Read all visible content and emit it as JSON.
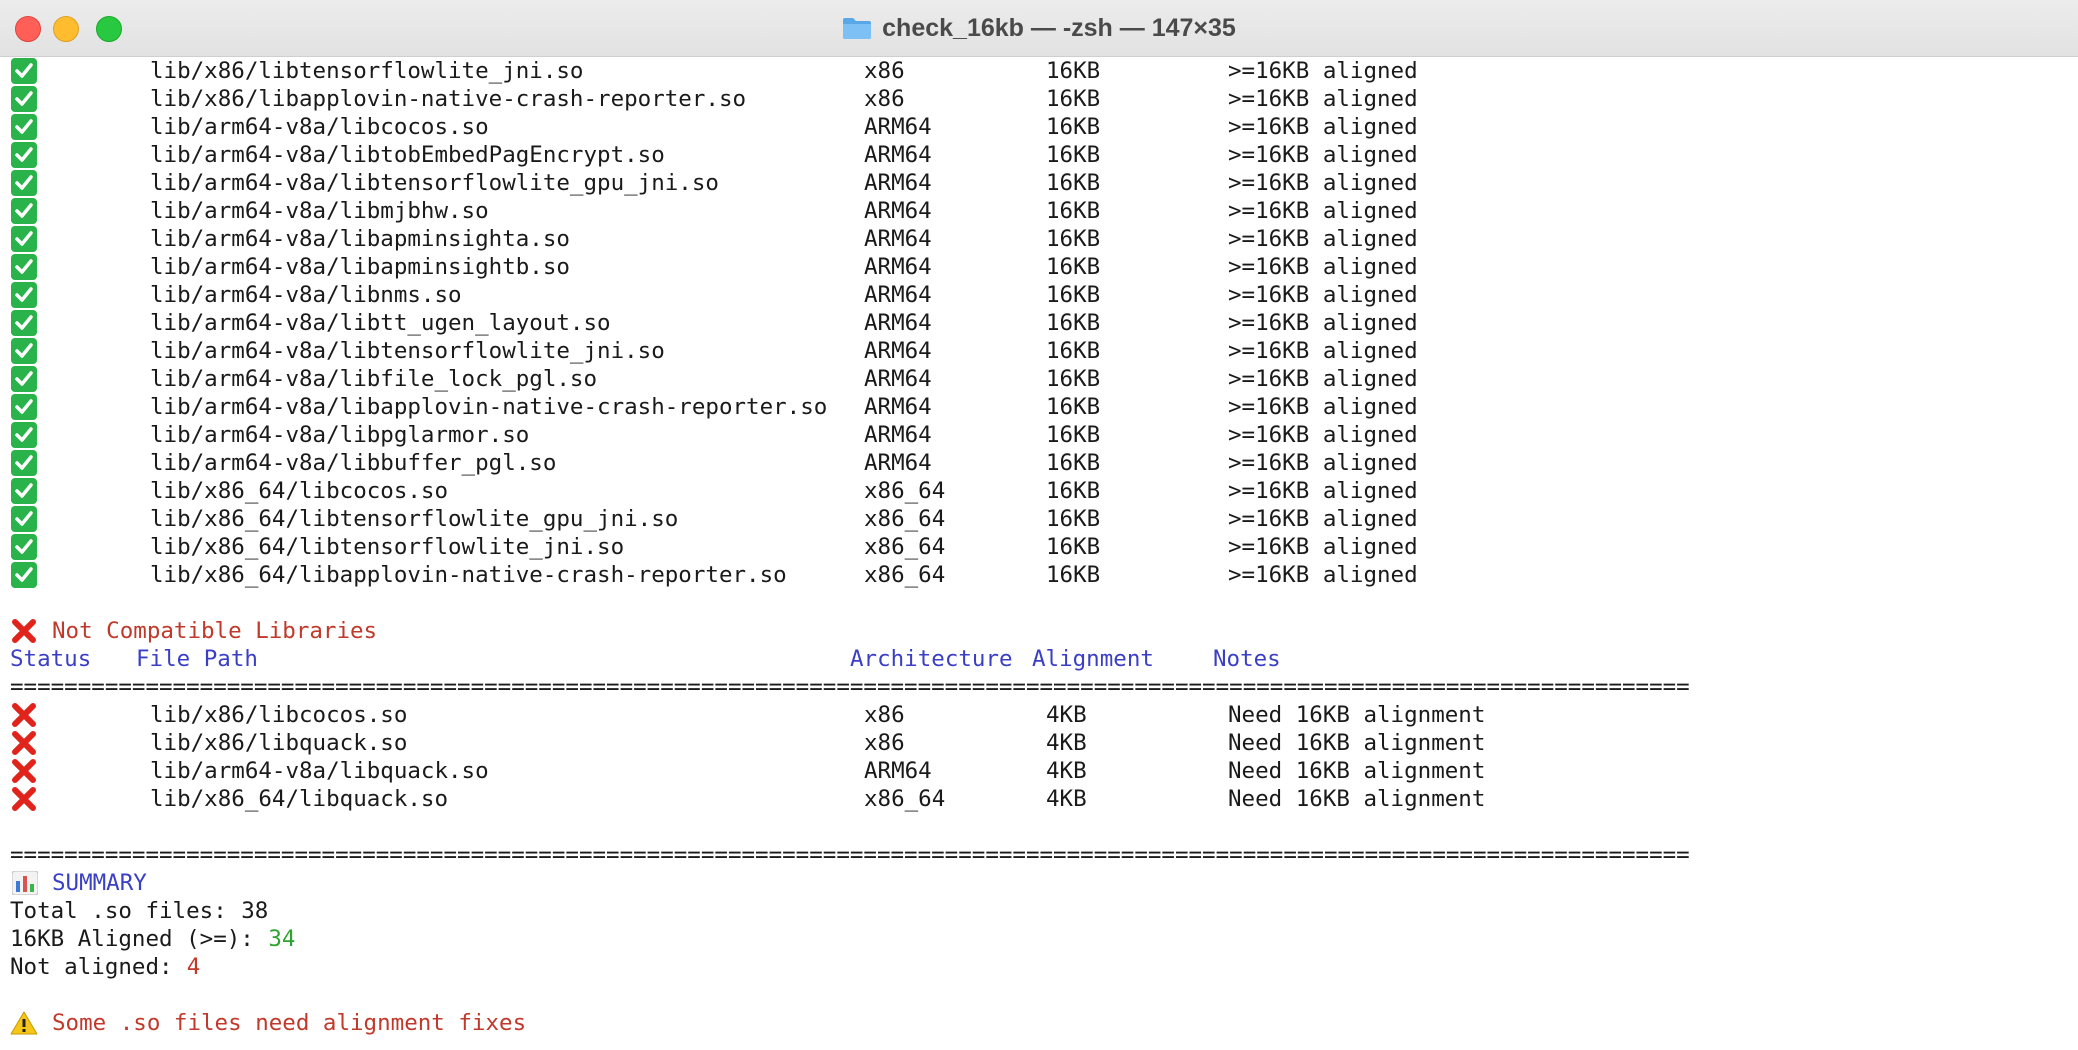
{
  "window": {
    "title": "check_16kb — -zsh — 147×35",
    "folder_icon": "folder-icon"
  },
  "colors": {
    "check": "#29b34a",
    "cross": "#e0241b",
    "header_blue": "#3a3fc4",
    "red_text": "#c0392b",
    "green_text": "#2fa32f"
  },
  "aligned_rows": [
    {
      "path": "lib/x86/libtensorflowlite_jni.so",
      "arch": "x86",
      "size": "16KB",
      "note": ">=16KB aligned"
    },
    {
      "path": "lib/x86/libapplovin-native-crash-reporter.so",
      "arch": "x86",
      "size": "16KB",
      "note": ">=16KB aligned"
    },
    {
      "path": "lib/arm64-v8a/libcocos.so",
      "arch": "ARM64",
      "size": "16KB",
      "note": ">=16KB aligned"
    },
    {
      "path": "lib/arm64-v8a/libtobEmbedPagEncrypt.so",
      "arch": "ARM64",
      "size": "16KB",
      "note": ">=16KB aligned"
    },
    {
      "path": "lib/arm64-v8a/libtensorflowlite_gpu_jni.so",
      "arch": "ARM64",
      "size": "16KB",
      "note": ">=16KB aligned"
    },
    {
      "path": "lib/arm64-v8a/libmjbhw.so",
      "arch": "ARM64",
      "size": "16KB",
      "note": ">=16KB aligned"
    },
    {
      "path": "lib/arm64-v8a/libapminsighta.so",
      "arch": "ARM64",
      "size": "16KB",
      "note": ">=16KB aligned"
    },
    {
      "path": "lib/arm64-v8a/libapminsightb.so",
      "arch": "ARM64",
      "size": "16KB",
      "note": ">=16KB aligned"
    },
    {
      "path": "lib/arm64-v8a/libnms.so",
      "arch": "ARM64",
      "size": "16KB",
      "note": ">=16KB aligned"
    },
    {
      "path": "lib/arm64-v8a/libtt_ugen_layout.so",
      "arch": "ARM64",
      "size": "16KB",
      "note": ">=16KB aligned"
    },
    {
      "path": "lib/arm64-v8a/libtensorflowlite_jni.so",
      "arch": "ARM64",
      "size": "16KB",
      "note": ">=16KB aligned"
    },
    {
      "path": "lib/arm64-v8a/libfile_lock_pgl.so",
      "arch": "ARM64",
      "size": "16KB",
      "note": ">=16KB aligned"
    },
    {
      "path": "lib/arm64-v8a/libapplovin-native-crash-reporter.so",
      "arch": "ARM64",
      "size": "16KB",
      "note": ">=16KB aligned"
    },
    {
      "path": "lib/arm64-v8a/libpglarmor.so",
      "arch": "ARM64",
      "size": "16KB",
      "note": ">=16KB aligned"
    },
    {
      "path": "lib/arm64-v8a/libbuffer_pgl.so",
      "arch": "ARM64",
      "size": "16KB",
      "note": ">=16KB aligned"
    },
    {
      "path": "lib/x86_64/libcocos.so",
      "arch": "x86_64",
      "size": "16KB",
      "note": ">=16KB aligned"
    },
    {
      "path": "lib/x86_64/libtensorflowlite_gpu_jni.so",
      "arch": "x86_64",
      "size": "16KB",
      "note": ">=16KB aligned"
    },
    {
      "path": "lib/x86_64/libtensorflowlite_jni.so",
      "arch": "x86_64",
      "size": "16KB",
      "note": ">=16KB aligned"
    },
    {
      "path": "lib/x86_64/libapplovin-native-crash-reporter.so",
      "arch": "x86_64",
      "size": "16KB",
      "note": ">=16KB aligned"
    }
  ],
  "not_compatible": {
    "title": "Not Compatible Libraries",
    "headers": {
      "status": "Status",
      "path": "File Path",
      "arch": "Architecture",
      "alignment": "Alignment",
      "notes": "Notes"
    },
    "rule": "================================================================================================================================",
    "rows": [
      {
        "path": "lib/x86/libcocos.so",
        "arch": "x86",
        "size": "4KB",
        "note": "Need 16KB alignment"
      },
      {
        "path": "lib/x86/libquack.so",
        "arch": "x86",
        "size": "4KB",
        "note": "Need 16KB alignment"
      },
      {
        "path": "lib/arm64-v8a/libquack.so",
        "arch": "ARM64",
        "size": "4KB",
        "note": "Need 16KB alignment"
      },
      {
        "path": "lib/x86_64/libquack.so",
        "arch": "x86_64",
        "size": "4KB",
        "note": "Need 16KB alignment"
      }
    ]
  },
  "summary": {
    "rule": "================================================================================================================================",
    "title": "SUMMARY",
    "total_label": "Total .so files: ",
    "total_value": "38",
    "aligned_label": "16KB Aligned (>=): ",
    "aligned_value": "34",
    "not_aligned_label": "Not aligned: ",
    "not_aligned_value": "4",
    "warning": "Some .so files need alignment fixes"
  }
}
